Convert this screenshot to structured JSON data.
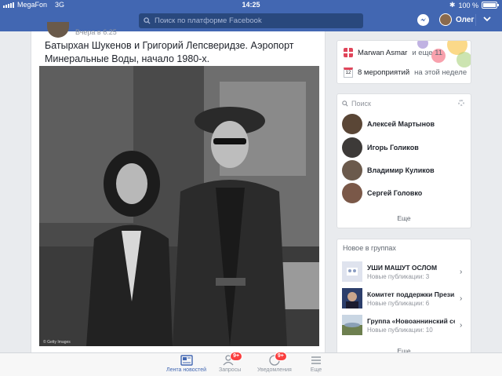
{
  "status_bar": {
    "carrier": "MegaFon",
    "network": "3G",
    "time": "14:25",
    "bluetooth_icon": "bluetooth-icon",
    "battery_percent": "100 %",
    "battery_level": 1.0
  },
  "header": {
    "search_placeholder": "Поиск по платформе Facebook",
    "user_name": "Олег",
    "brand_color": "#4267b2"
  },
  "post": {
    "timestamp": "Вчера в 6:25",
    "text": "Батырхан Шукенов и Григорий Лепсверидзе. Аэропорт Минеральные Воды, начало 1980-х.",
    "photo_credit": "© Getty Images"
  },
  "reminders": {
    "birthday_name": "Marwan Asmar",
    "birthday_suffix": "и еще 11",
    "calendar_day": "12",
    "events_count": "8 мероприятий",
    "events_suffix": "на этой неделе"
  },
  "contacts": {
    "search_placeholder": "Поиск",
    "items": [
      {
        "name": "Алексей Мартынов",
        "color": "#5a4636"
      },
      {
        "name": "Игорь Голиков",
        "color": "#3d3a38"
      },
      {
        "name": "Владимир Куликов",
        "color": "#6b5a4c"
      },
      {
        "name": "Сергей Головко",
        "color": "#7a5848"
      }
    ],
    "more_label": "Еще"
  },
  "groups": {
    "title": "Новое в группах",
    "items": [
      {
        "name": "УШИ МАШУТ ОСЛОМ",
        "sub": "Новые публикации: 3"
      },
      {
        "name": "Комитет поддержки Прези...",
        "sub": "Новые публикации: 6"
      },
      {
        "name": "Группа «Новоаннинский се...",
        "sub": "Новые публикации: 10"
      }
    ],
    "more_label": "Еще"
  },
  "bottom_nav": {
    "items": [
      {
        "label": "Лента новостей",
        "icon": "news-feed-icon",
        "active": true
      },
      {
        "label": "Запросы",
        "icon": "friend-requests-icon",
        "badge": "9+"
      },
      {
        "label": "Уведомления",
        "icon": "notifications-icon",
        "badge": "9+"
      },
      {
        "label": "Еще",
        "icon": "menu-icon"
      }
    ]
  }
}
